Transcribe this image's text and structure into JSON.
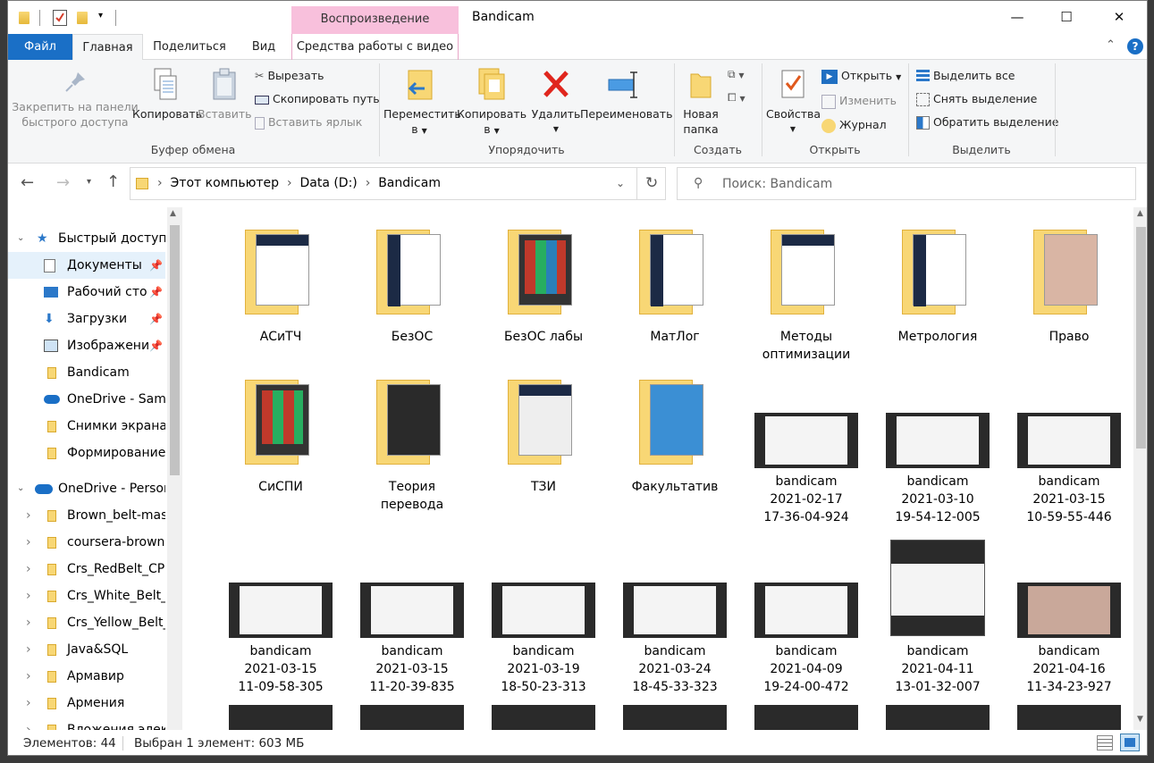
{
  "window": {
    "title": "Bandicam",
    "context_tab_group": "Воспроизведение"
  },
  "window_controls": {
    "minimize": "—",
    "maximize": "☐",
    "close": "✕"
  },
  "tabs": {
    "file": "Файл",
    "home": "Главная",
    "share": "Поделиться",
    "view": "Вид",
    "video_tools": "Средства работы с видео"
  },
  "ribbon": {
    "clipboard": {
      "pin_line1": "Закрепить на панели",
      "pin_line2": "быстрого доступа",
      "copy": "Копировать",
      "paste": "Вставить",
      "cut": "Вырезать",
      "copy_path": "Скопировать путь",
      "paste_shortcut": "Вставить ярлык",
      "label": "Буфер обмена"
    },
    "organize": {
      "move_line1": "Переместить",
      "move_line2": "в",
      "copyto_line1": "Копировать",
      "copyto_line2": "в",
      "delete": "Удалить",
      "rename": "Переименовать",
      "label": "Упорядочить"
    },
    "new": {
      "folder_line1": "Новая",
      "folder_line2": "папка",
      "label": "Создать"
    },
    "open": {
      "properties": "Свойства",
      "open": "Открыть",
      "edit": "Изменить",
      "history": "Журнал",
      "label": "Открыть"
    },
    "select": {
      "all": "Выделить все",
      "none": "Снять выделение",
      "invert": "Обратить выделение",
      "label": "Выделить"
    }
  },
  "address": {
    "crumbs": [
      "Этот компьютер",
      "Data (D:)",
      "Bandicam"
    ],
    "search_placeholder": "Поиск: Bandicam"
  },
  "nav": {
    "quick_access": "Быстрый доступ",
    "items": [
      "Документы",
      "Рабочий сто",
      "Загрузки",
      "Изображени",
      "Bandicam",
      "OneDrive - Sama",
      "Снимки экрана",
      "Формирование"
    ],
    "onedrive": "OneDrive - Person",
    "od_items": [
      "Brown_belt-mast",
      "coursera-brown-",
      "Crs_RedBelt_CPP",
      "Crs_White_Belt_C",
      "Crs_Yellow_Belt_C",
      "Java&SQL",
      "Армавир",
      "Армения",
      "Вложения элект"
    ]
  },
  "folders": [
    {
      "name": "АСиТЧ",
      "name2": ""
    },
    {
      "name": "БезОС",
      "name2": ""
    },
    {
      "name": "БезОС лабы",
      "name2": ""
    },
    {
      "name": "МатЛог",
      "name2": ""
    },
    {
      "name": "Методы",
      "name2": "оптимизации"
    },
    {
      "name": "Метрология",
      "name2": ""
    },
    {
      "name": "Право",
      "name2": ""
    },
    {
      "name": "СиСПИ",
      "name2": ""
    },
    {
      "name": "Теория",
      "name2": "перевода"
    },
    {
      "name": "ТЗИ",
      "name2": ""
    },
    {
      "name": "Факультатив",
      "name2": ""
    }
  ],
  "videos": [
    {
      "l1": "bandicam",
      "l2": "2021-02-17",
      "l3": "17-36-04-924"
    },
    {
      "l1": "bandicam",
      "l2": "2021-03-10",
      "l3": "19-54-12-005"
    },
    {
      "l1": "bandicam",
      "l2": "2021-03-15",
      "l3": "10-59-55-446"
    },
    {
      "l1": "bandicam",
      "l2": "2021-03-15",
      "l3": "11-09-58-305"
    },
    {
      "l1": "bandicam",
      "l2": "2021-03-15",
      "l3": "11-20-39-835"
    },
    {
      "l1": "bandicam",
      "l2": "2021-03-19",
      "l3": "18-50-23-313"
    },
    {
      "l1": "bandicam",
      "l2": "2021-03-24",
      "l3": "18-45-33-323"
    },
    {
      "l1": "bandicam",
      "l2": "2021-04-09",
      "l3": "19-24-00-472"
    },
    {
      "l1": "bandicam",
      "l2": "2021-04-11",
      "l3": "13-01-32-007"
    },
    {
      "l1": "bandicam",
      "l2": "2021-04-16",
      "l3": "11-34-23-927"
    }
  ],
  "status": {
    "count": "Элементов: 44",
    "selected": "Выбран 1 элемент: 603 МБ"
  },
  "colors": {
    "accent": "#1a6fc6",
    "folder": "#f8d775",
    "context_tab": "#f8c0dc",
    "selection": "#e5f1fb"
  }
}
